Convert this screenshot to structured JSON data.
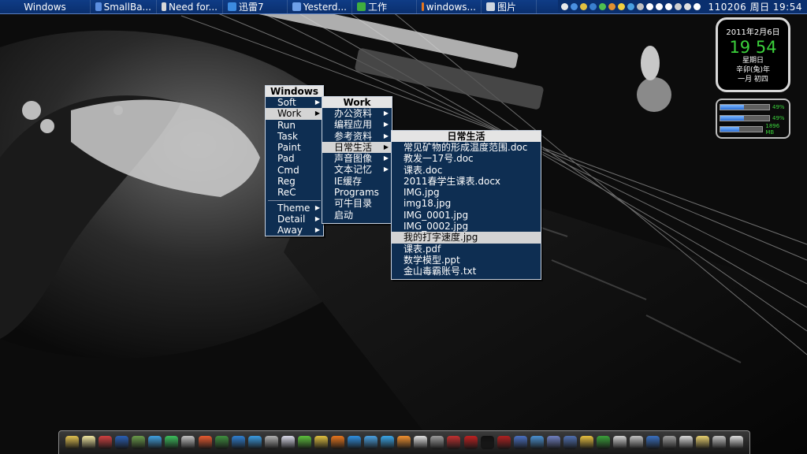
{
  "taskbar": {
    "start_label": "Windows",
    "items": [
      {
        "label": "SmallBa...",
        "icon": "window-icon",
        "color": "#5b8ee0"
      },
      {
        "label": "Need for...",
        "icon": "app-icon",
        "color": "#d9d9d9"
      },
      {
        "label": "迅雷7",
        "icon": "thunder-icon",
        "color": "#3c8be0"
      },
      {
        "label": "Yesterd...",
        "icon": "folder-icon",
        "color": "#6fa0e8"
      },
      {
        "label": "工作",
        "icon": "tree-icon",
        "color": "#3fae3f"
      },
      {
        "label": "windows...",
        "icon": "firefox-icon",
        "color": "#e8761d"
      },
      {
        "label": "图片",
        "icon": "photo-icon",
        "color": "#cfd6e0"
      }
    ],
    "tray_clock": "110206 周日 19:54"
  },
  "clock_gadget": {
    "date": "2011年2月6日",
    "time": "19 54",
    "weekday": "星期日",
    "lunar_year": "辛卯(兔)年",
    "lunar_date": "一月 初四"
  },
  "meter_gadget": {
    "rows": [
      {
        "label": "49%",
        "level": 0.49
      },
      {
        "label": "49%",
        "level": 0.49
      },
      {
        "label": "1896 MB",
        "level": 0.45
      }
    ]
  },
  "menu_windows": {
    "title": "Windows",
    "groups": [
      [
        {
          "label": "Soft",
          "submenu": true
        },
        {
          "label": "Work",
          "submenu": true,
          "active": true
        },
        {
          "label": "Run",
          "submenu": false
        },
        {
          "label": "Task",
          "submenu": false
        },
        {
          "label": "Paint",
          "submenu": false
        },
        {
          "label": "Pad",
          "submenu": false
        },
        {
          "label": "Cmd",
          "submenu": false
        },
        {
          "label": "Reg",
          "submenu": false
        },
        {
          "label": "ReC",
          "submenu": false
        }
      ],
      [
        {
          "label": "Theme",
          "submenu": true
        },
        {
          "label": "Detail",
          "submenu": true
        },
        {
          "label": "Away",
          "submenu": true
        }
      ]
    ]
  },
  "menu_work": {
    "title": "Work",
    "items": [
      {
        "label": "办公资料",
        "submenu": true
      },
      {
        "label": "编程应用",
        "submenu": true
      },
      {
        "label": "参考资料",
        "submenu": true
      },
      {
        "label": "日常生活",
        "submenu": true,
        "active": true
      },
      {
        "label": "声音图像",
        "submenu": true
      },
      {
        "label": "文本记忆",
        "submenu": true
      },
      {
        "label": "IE缓存",
        "submenu": false
      },
      {
        "label": "Programs",
        "submenu": false
      },
      {
        "label": "可牛目录",
        "submenu": false
      },
      {
        "label": "启动",
        "submenu": false
      }
    ]
  },
  "menu_daily": {
    "title": "日常生活",
    "items": [
      {
        "label": "常见矿物的形成温度范围.doc"
      },
      {
        "label": "教发一17号.doc"
      },
      {
        "label": "课表.doc"
      },
      {
        "label": "2011春学生课表.docx"
      },
      {
        "label": "IMG.jpg"
      },
      {
        "label": "img18.jpg"
      },
      {
        "label": "IMG_0001.jpg"
      },
      {
        "label": "IMG_0002.jpg"
      },
      {
        "label": "我的打字速度.jpg",
        "highlighted": true
      },
      {
        "label": "课表.pdf"
      },
      {
        "label": "数学模型.ppt"
      },
      {
        "label": "金山毒霸账号.txt"
      }
    ]
  },
  "dock": {
    "icons": [
      {
        "name": "paint-icon",
        "color": "#e0c050"
      },
      {
        "name": "mail-icon",
        "color": "#f0e6a0"
      },
      {
        "name": "palette-icon",
        "color": "#d04040"
      },
      {
        "name": "word-icon",
        "color": "#2a5fb5"
      },
      {
        "name": "chart-icon",
        "color": "#6a9a4a"
      },
      {
        "name": "balls-icon",
        "color": "#40a0e0"
      },
      {
        "name": "green-app-icon",
        "color": "#3cbf5c"
      },
      {
        "name": "pen-icon",
        "color": "#c0c0c0"
      },
      {
        "name": "picasa-icon",
        "color": "#e85a30"
      },
      {
        "name": "globe-icon",
        "color": "#3f8f3f"
      },
      {
        "name": "shield-icon",
        "color": "#2f7fd0"
      },
      {
        "name": "ie-icon",
        "color": "#3a9ae0"
      },
      {
        "name": "tools-icon",
        "color": "#b0b0b0"
      },
      {
        "name": "disc-icon",
        "color": "#d8d8e8"
      },
      {
        "name": "clover-icon",
        "color": "#5cc03c"
      },
      {
        "name": "wiki-icon",
        "color": "#e0c040"
      },
      {
        "name": "firefox-icon",
        "color": "#e8761d"
      },
      {
        "name": "sogou-icon",
        "color": "#2f8fe0"
      },
      {
        "name": "bird-icon",
        "color": "#4aa0e0"
      },
      {
        "name": "qq-icon",
        "color": "#3aa6e8"
      },
      {
        "name": "fox-icon",
        "color": "#f09030"
      },
      {
        "name": "chess-icon",
        "color": "#e0e0e0"
      },
      {
        "name": "counter-strike-icon",
        "color": "#9a9a9a"
      },
      {
        "name": "nfs-icon",
        "color": "#c03030"
      },
      {
        "name": "flash-icon",
        "color": "#c02020"
      },
      {
        "name": "terminal-icon",
        "color": "#101010"
      },
      {
        "name": "sixty-four-icon",
        "color": "#b02020"
      },
      {
        "name": "calc-icon",
        "color": "#4a70c0"
      },
      {
        "name": "network-icon",
        "color": "#4a90d0"
      },
      {
        "name": "image-icon",
        "color": "#7080c0"
      },
      {
        "name": "monitor-icon",
        "color": "#5070b0"
      },
      {
        "name": "folder-icon",
        "color": "#e8c040"
      },
      {
        "name": "tree-icon",
        "color": "#3aa03a"
      },
      {
        "name": "cd-icon",
        "color": "#d0d0d0"
      },
      {
        "name": "people-icon",
        "color": "#c0c0c0"
      },
      {
        "name": "screen-icon",
        "color": "#3a70c0"
      },
      {
        "name": "gear-icon",
        "color": "#9a9a9a"
      },
      {
        "name": "files-icon",
        "color": "#d8d8d8"
      },
      {
        "name": "document-icon",
        "color": "#e8d070"
      },
      {
        "name": "recycle-bin-icon",
        "color": "#bfbfbf"
      },
      {
        "name": "trash-icon",
        "color": "#dcdcdc"
      }
    ]
  }
}
